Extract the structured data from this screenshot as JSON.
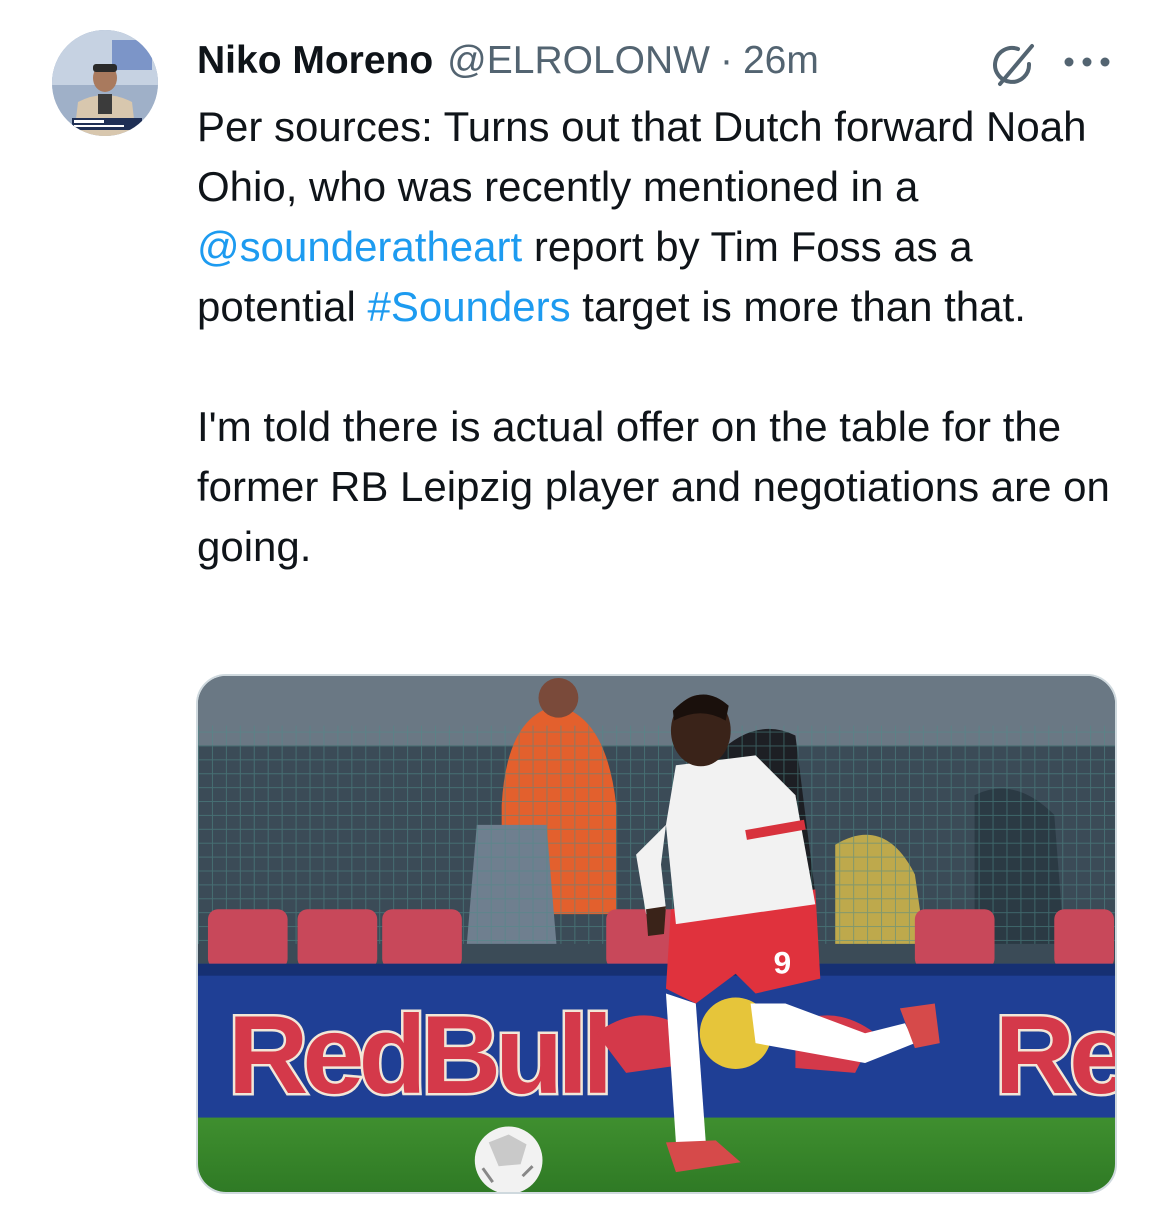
{
  "tweet": {
    "author": {
      "display_name": "Niko Moreno",
      "handle": "@ELROLONW",
      "separator": "·",
      "timestamp": "26m"
    },
    "text": {
      "p1_part1": "Per sources: Turns out that Dutch forward Noah Ohio, who was recently mentioned in a ",
      "mention": "@sounderatheart",
      "p1_part2": " report by Tim Foss as a potential ",
      "hashtag": "#Sounders",
      "p1_part3": " target is more than that.",
      "p2": "I'm told there is actual offer on the table for the former RB Leipzig player and negotiations are on going."
    },
    "media": {
      "banner_text_left": "RedBull",
      "banner_text_right": "Re",
      "shirt_number": "9"
    },
    "icons": {
      "grok": "grok-icon",
      "more": "more-icon"
    },
    "colors": {
      "link": "#1d9bf0",
      "secondary_text": "#536471",
      "primary_text": "#0f1419"
    }
  }
}
